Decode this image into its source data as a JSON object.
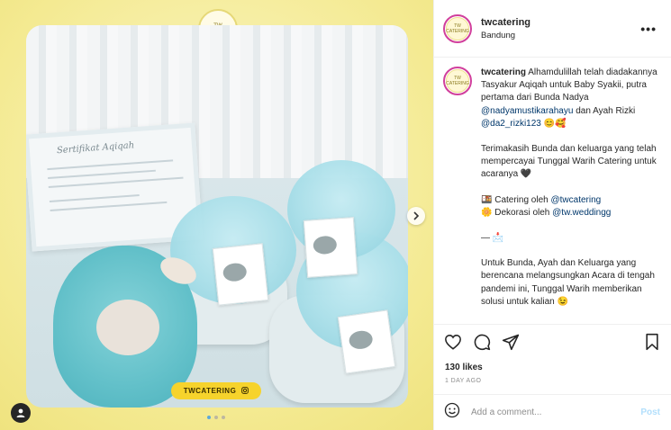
{
  "post": {
    "media": {
      "logo_text": "TW CATERING",
      "certificate_title": "Sertifikat Aqiqah",
      "brand_pill": "TWCATERING",
      "carousel_dots": 3,
      "active_dot": 1
    },
    "header": {
      "username": "twcatering",
      "location": "Bandung",
      "more_label": "•••"
    },
    "caption": {
      "username": "twcatering",
      "p1": "Alhamdulillah telah diadakannya Tasyakur Aqiqah untuk Baby Syakii, putra pertama dari Bunda Nadya ",
      "mention1": "@nadyamustikarahayu",
      "p1b": " dan Ayah Rizki ",
      "mention2": "@da2_rizki123",
      "p1c": " 😊🥰",
      "p2": "Terimakasih Bunda dan keluarga yang telah mempercayai Tunggal Warih Catering untuk acaranya 🖤",
      "line_catering": "🍱 Catering oleh ",
      "mention3": "@twcatering",
      "line_dekorasi": "🌼 Dekorasi oleh ",
      "mention4": "@tw.weddingg",
      "divider": "— 📩",
      "p4": "Untuk Bunda, Ayah dan Keluarga yang berencana melangsungkan Acara di tengah pandemi ini, Tunggal Warih memberikan solusi untuk kalian 😉"
    },
    "stats": {
      "likes": "130 likes",
      "date": "1 DAY AGO"
    },
    "comment_box": {
      "placeholder": "Add a comment...",
      "post_label": "Post"
    },
    "colors": {
      "media_bg": "#f4ea92",
      "story_ring": "#d13f9c",
      "link": "#00376b",
      "post_disabled": "#b2dffc"
    }
  }
}
